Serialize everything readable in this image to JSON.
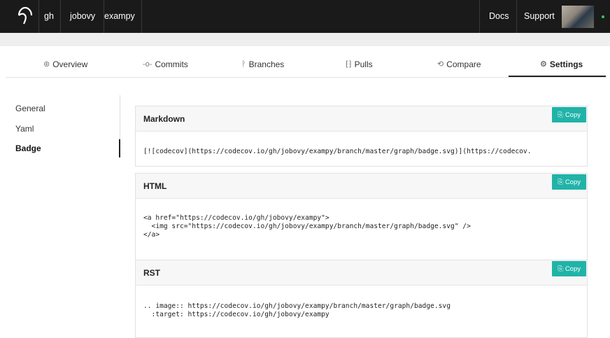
{
  "nav": {
    "crumbs": [
      "gh",
      "jobovy",
      "exampy"
    ],
    "docs": "Docs",
    "support": "Support",
    "status_color": "#3cc36a"
  },
  "tabs": [
    {
      "label": "Overview",
      "icon": "overview-icon",
      "glyph": "⊛"
    },
    {
      "label": "Commits",
      "icon": "commit-icon",
      "glyph": "-o-"
    },
    {
      "label": "Branches",
      "icon": "branch-icon",
      "glyph": "ᚹ"
    },
    {
      "label": "Pulls",
      "icon": "pull-request-icon",
      "glyph": "⁅⁆"
    },
    {
      "label": "Compare",
      "icon": "compare-icon",
      "glyph": "⟲"
    },
    {
      "label": "Settings",
      "icon": "gears-icon",
      "glyph": "⚙"
    }
  ],
  "active_tab": "Settings",
  "sidebar": {
    "items": [
      "General",
      "Yaml",
      "Badge"
    ],
    "active": "Badge"
  },
  "copy_label": "Copy",
  "accent": "#21b3a8",
  "panels": {
    "markdown": {
      "title": "Markdown",
      "line1": "[![codecov](https://codecov.io/gh/jobovy/exampy/branch/master/graph/badge.svg)](https://codecov."
    },
    "html": {
      "title": "HTML",
      "line1": "<a href=\"https://codecov.io/gh/jobovy/exampy\">",
      "line2": "  <img src=\"https://codecov.io/gh/jobovy/exampy/branch/master/graph/badge.svg\" />",
      "line3": "</a>"
    },
    "rst": {
      "title": "RST",
      "line1": ".. image:: https://codecov.io/gh/jobovy/exampy/branch/master/graph/badge.svg",
      "line2": "  :target: https://codecov.io/gh/jobovy/exampy"
    }
  }
}
